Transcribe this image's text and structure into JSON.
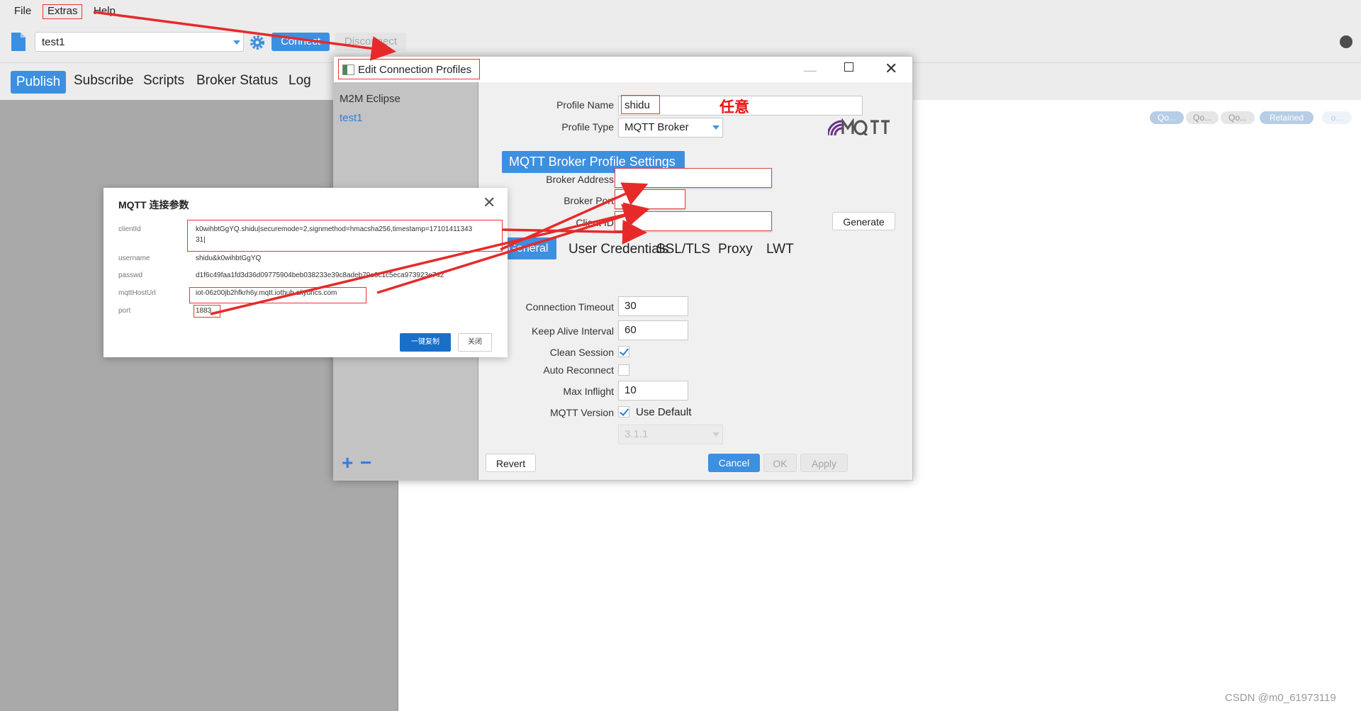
{
  "menu": [
    "File",
    "Extras",
    "Help"
  ],
  "toolbar": {
    "profile": "test1",
    "connect": "Connect",
    "disconnect": "Disconnect"
  },
  "tabs": [
    "Publish",
    "Subscribe",
    "Scripts",
    "Broker Status",
    "Log"
  ],
  "qos": [
    "Qo...",
    "Qo...",
    "Qo...",
    "Retained",
    "o..."
  ],
  "dialog": {
    "title": "Edit Connection Profiles",
    "profiles": [
      "M2M Eclipse",
      "test1"
    ],
    "profile_name_label": "Profile Name",
    "profile_name_value": "shidu",
    "annotation": "任意",
    "profile_type_label": "Profile Type",
    "profile_type_value": "MQTT Broker",
    "section_title": "MQTT Broker Profile Settings",
    "broker_address_label": "Broker Address",
    "broker_port_label": "Broker Port",
    "client_id_label": "Client ID",
    "generate": "Generate",
    "subtabs": [
      "General",
      "User Credentials",
      "SSL/TLS",
      "Proxy",
      "LWT"
    ],
    "connection_timeout_label": "Connection Timeout",
    "connection_timeout_value": "30",
    "keep_alive_label": "Keep Alive Interval",
    "keep_alive_value": "60",
    "clean_session_label": "Clean Session",
    "auto_reconnect_label": "Auto Reconnect",
    "max_inflight_label": "Max Inflight",
    "max_inflight_value": "10",
    "mqtt_version_label": "MQTT Version",
    "use_default_label": "Use Default",
    "version_value": "3.1.1",
    "revert": "Revert",
    "cancel": "Cancel",
    "ok": "OK",
    "apply": "Apply",
    "add": "+",
    "remove": "−"
  },
  "popup": {
    "title": "MQTT 连接参数",
    "client_id_label": "clientId",
    "client_id_value_line1": "k0wihbtGgYQ.shidu|securemode=2,signmethod=hmacsha256,timestamp=17101411343",
    "client_id_value_line2": "31|",
    "username_label": "username",
    "username_value": "shidu&k0wihbtGgYQ",
    "passwd_label": "passwd",
    "passwd_value": "d1f6c49faa1fd3d36d09775904beb038233e39c8adeb79e3c1c5eca973923e742",
    "host_label": "mqttHostUrl",
    "host_value": "iot-06z00jb2hfkrh6y.mqtt.iothub.aliyuncs.com",
    "port_label": "port",
    "port_value": "1883",
    "copy": "一键复制",
    "close": "关闭"
  },
  "watermark": "CSDN @m0_61973119"
}
